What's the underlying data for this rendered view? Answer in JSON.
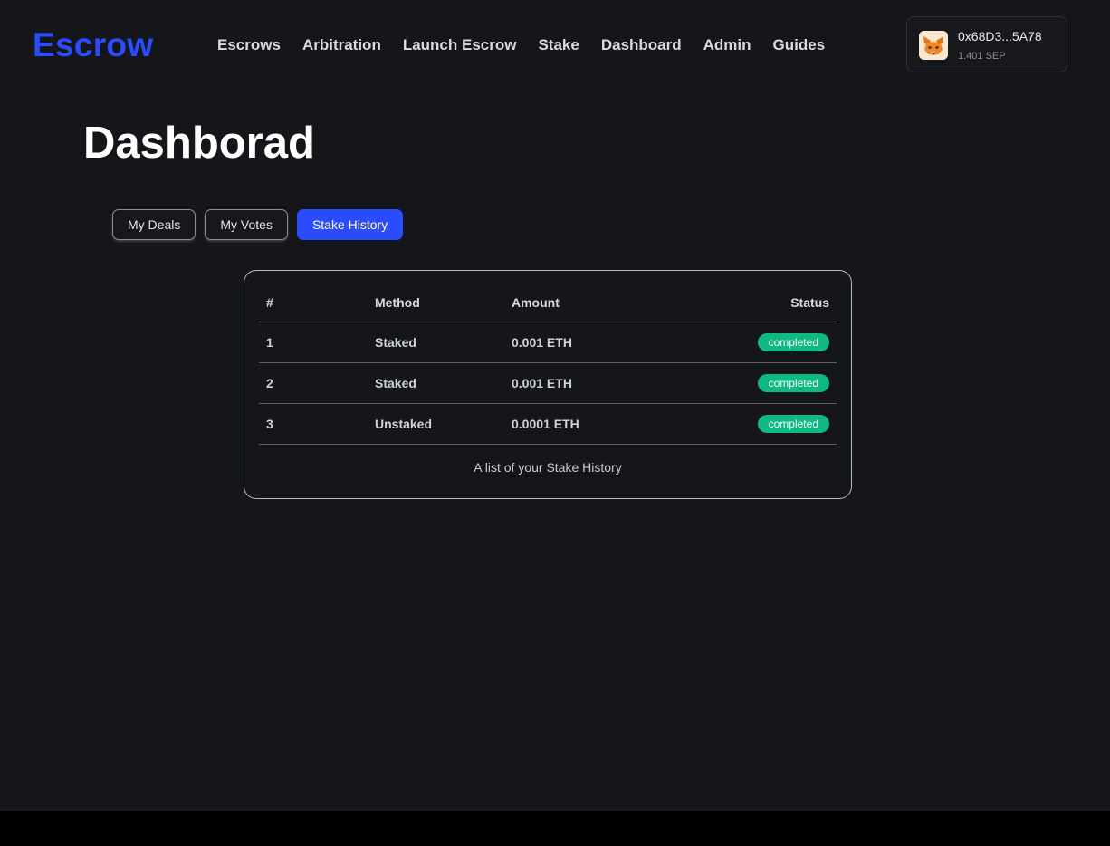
{
  "header": {
    "logo": "Escrow",
    "nav": [
      "Escrows",
      "Arbitration",
      "Launch Escrow",
      "Stake",
      "Dashboard",
      "Admin",
      "Guides"
    ],
    "wallet": {
      "address": "0x68D3...5A78",
      "balance": "1.401 SEP",
      "avatar_icon": "metamask-fox-icon"
    }
  },
  "page": {
    "title": "Dashborad"
  },
  "tabs": [
    {
      "label": "My Deals",
      "active": false
    },
    {
      "label": "My Votes",
      "active": false
    },
    {
      "label": "Stake History",
      "active": true
    }
  ],
  "table": {
    "headers": [
      "#",
      "Method",
      "Amount",
      "Status"
    ],
    "rows": [
      {
        "num": "1",
        "method": "Staked",
        "amount": "0.001 ETH",
        "status": "completed"
      },
      {
        "num": "2",
        "method": "Staked",
        "amount": "0.001 ETH",
        "status": "completed"
      },
      {
        "num": "3",
        "method": "Unstaked",
        "amount": "0.0001 ETH",
        "status": "completed"
      }
    ],
    "caption": "A list of your Stake History"
  },
  "colors": {
    "brand": "#2b4bff",
    "status_completed": "#10b981",
    "background": "#15161a"
  }
}
